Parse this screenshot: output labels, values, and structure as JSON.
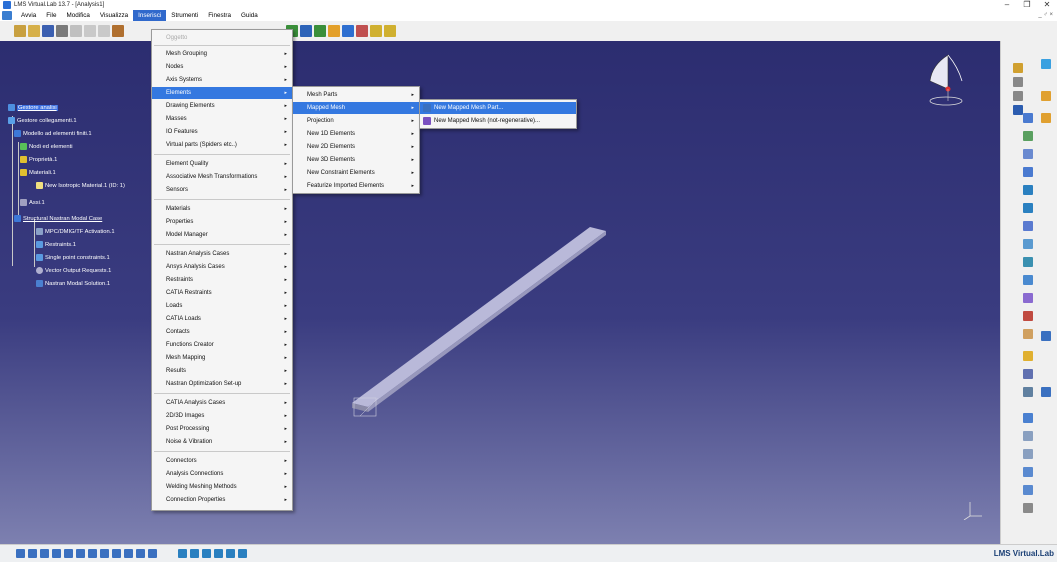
{
  "window": {
    "title": "LMS Virtual.Lab 13.7 - [Analysis1]",
    "minimize": "–",
    "restore": "❐",
    "close": "✕"
  },
  "menubar": {
    "items": [
      "Avvia",
      "File",
      "Modifica",
      "Visualizza",
      "Inserisci",
      "Strumenti",
      "Finestra",
      "Guida"
    ],
    "mdi_controls": "_ ♂ ×"
  },
  "tree": {
    "root": "Gestore analisi",
    "nodes": [
      "Gestore collegamenti.1",
      "Modello ad elementi finiti.1",
      "Nodi ed elementi",
      "Proprietà.1",
      "Materiali.1",
      "New Isotropic Material.1 (ID: 1)",
      "Assi.1",
      "Structural Nastran Modal Case",
      "MPC/DMIG/TF Activation.1",
      "Restraints.1",
      "Single point constraints.1",
      "Vector Output Requests.1",
      "Nastran Modal Solution.1"
    ]
  },
  "menu_inserisci": {
    "items": [
      "Oggetto",
      "Mesh Grouping",
      "Nodes",
      "Axis Systems",
      "Elements",
      "Drawing Elements",
      "Masses",
      "IO Features",
      "Virtual parts (Spiders etc..)",
      "Element Quality",
      "Associative Mesh Transformations",
      "Sensors",
      "Materials",
      "Properties",
      "Model Manager",
      "Nastran Analysis Cases",
      "Ansys Analysis Cases",
      "Restraints",
      "CATIA Restraints",
      "Loads",
      "CATIA Loads",
      "Contacts",
      "Functions Creator",
      "Mesh Mapping",
      "Results",
      "Nastran Optimization Set-up",
      "CATIA Analysis Cases",
      "2D/3D Images",
      "Post Processing",
      "Noise & Vibration",
      "Connectors",
      "Analysis Connections",
      "Welding Meshing Methods",
      "Connection Properties"
    ]
  },
  "menu_elements": {
    "items": [
      "Mesh Parts",
      "Mapped Mesh",
      "Projection",
      "New 1D Elements",
      "New 2D Elements",
      "New 3D Elements",
      "New Constraint Elements",
      "Featurize Imported Elements"
    ]
  },
  "menu_mapped_mesh": {
    "items": [
      "New Mapped Mesh Part...",
      "New Mapped Mesh (not-regenerative)..."
    ]
  },
  "statusbar": {
    "brand": "LMS Virtual.Lab"
  },
  "colors": {
    "accent": "#3478e0",
    "viewport_top": "#2c2d70",
    "viewport_bottom": "#7d80b0",
    "menu_active": "#3069cc"
  }
}
